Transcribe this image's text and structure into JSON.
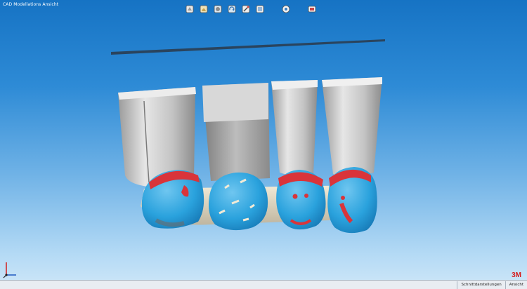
{
  "window": {
    "title": "CAD Modellations Ansicht"
  },
  "toolbar": {
    "buttons": [
      {
        "icon": "view-front-icon"
      },
      {
        "icon": "view-side-icon"
      },
      {
        "icon": "view-top-icon"
      },
      {
        "icon": "rotate-view-icon"
      },
      {
        "icon": "tools-icon"
      },
      {
        "icon": "layers-icon"
      },
      {
        "icon": "info-icon"
      },
      {
        "icon": "screenshot-icon"
      }
    ]
  },
  "brand": {
    "logo_text": "3M",
    "color": "#d51c1c"
  },
  "colors": {
    "contact_red": "#d9343a",
    "surface_blue": "#2aa2dd",
    "die_gray": "#c9c9c9"
  },
  "statusbar": {
    "tabs": [
      {
        "label": "Schnittdarstellungen"
      },
      {
        "label": "Ansicht"
      }
    ]
  }
}
